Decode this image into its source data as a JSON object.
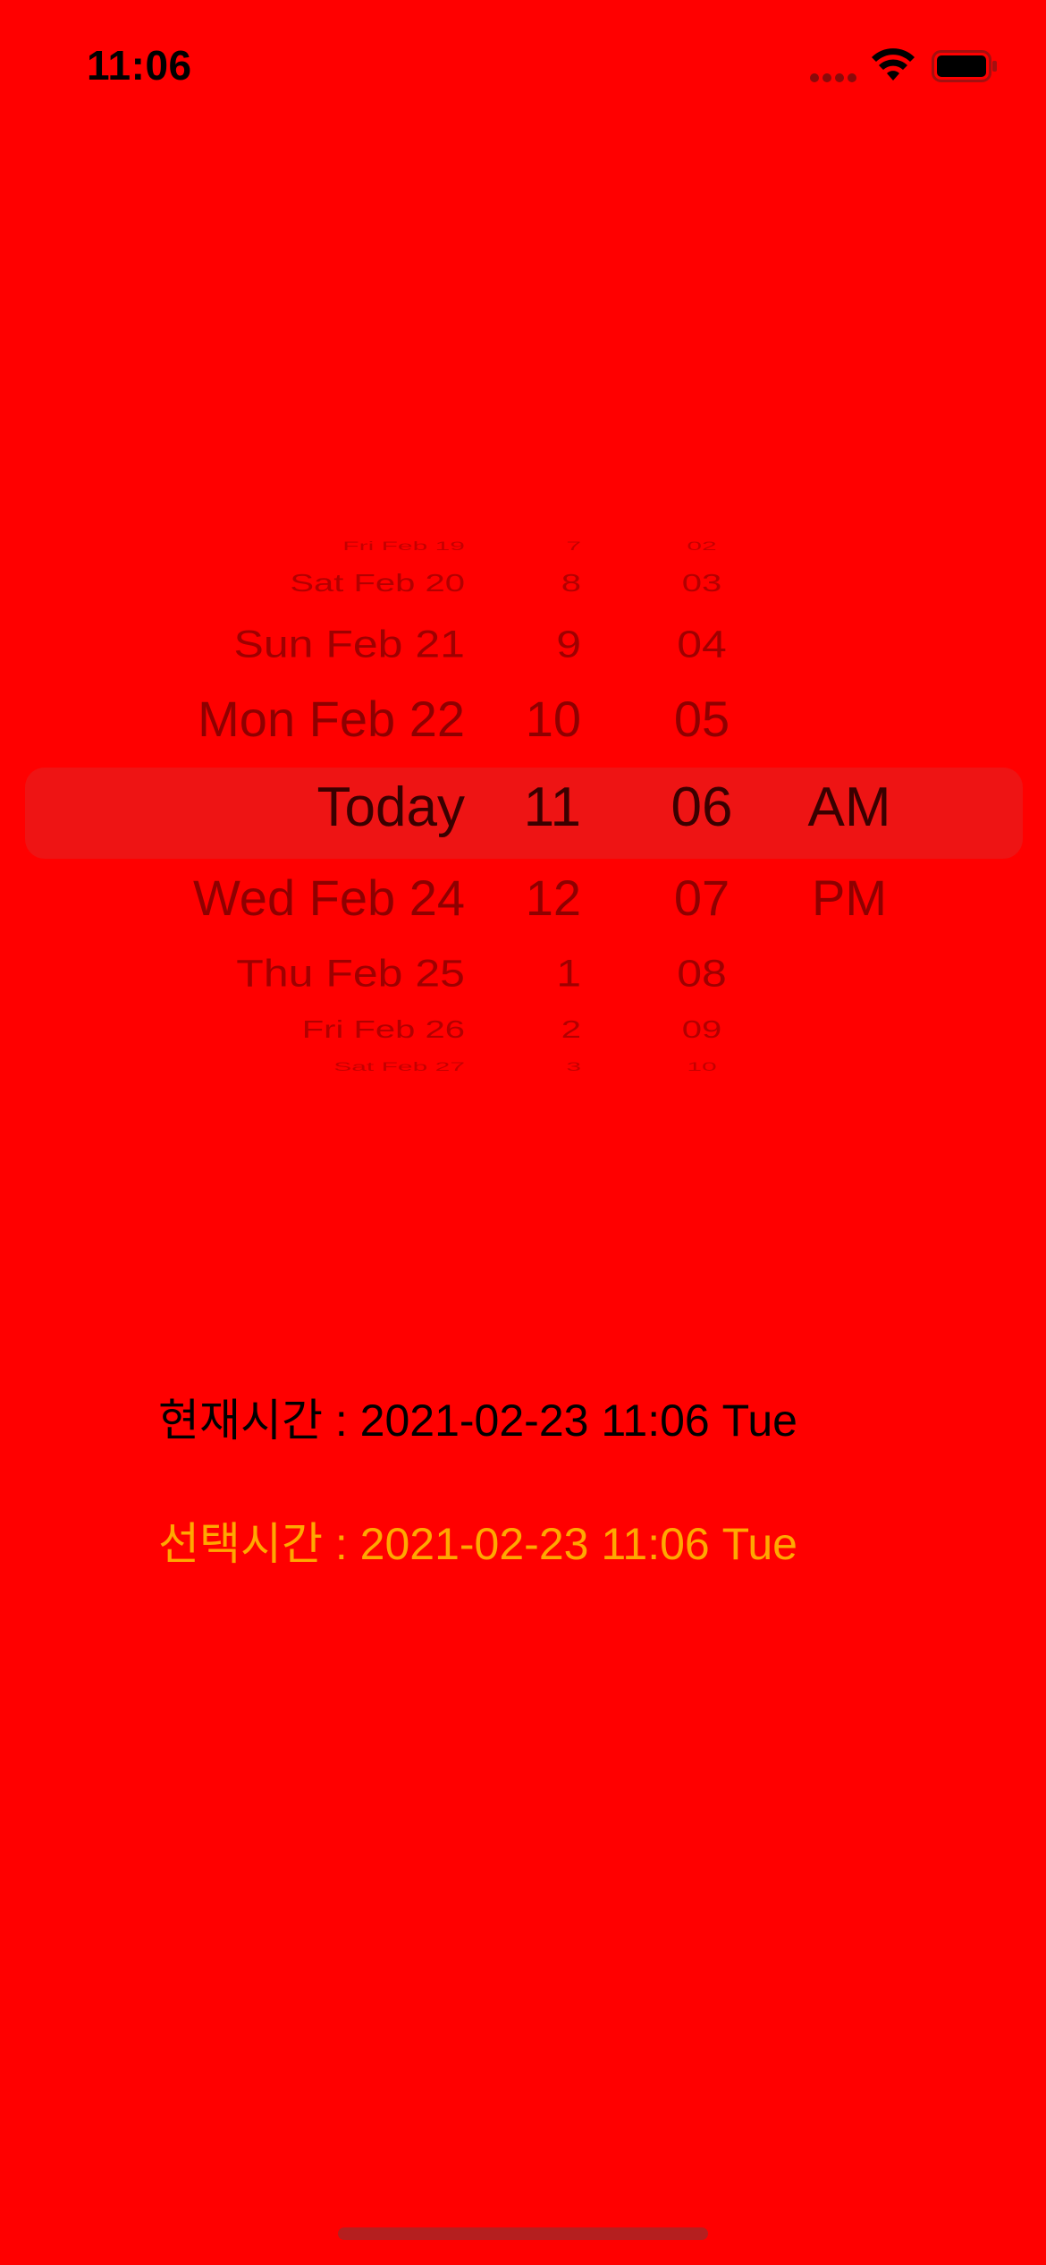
{
  "status_bar": {
    "time": "11:06",
    "icons": [
      "cellular-signal-icon",
      "wifi-icon",
      "battery-icon"
    ]
  },
  "picker": {
    "dates": [
      "Fri Feb 19",
      "Sat Feb 20",
      "Sun Feb 21",
      "Mon Feb 22",
      "Today",
      "Wed Feb 24",
      "Thu Feb 25",
      "Fri Feb 26",
      "Sat Feb 27"
    ],
    "hours": [
      "7",
      "8",
      "9",
      "10",
      "11",
      "12",
      "1",
      "2",
      "3"
    ],
    "minutes": [
      "02",
      "03",
      "04",
      "05",
      "06",
      "07",
      "08",
      "09",
      "10"
    ],
    "ampm": [
      "AM",
      "PM"
    ],
    "selected": {
      "date": "Today",
      "hour": "11",
      "minute": "06",
      "ampm": "AM"
    }
  },
  "info": {
    "current_time": "현재시간 : 2021-02-23 11:06 Tue",
    "selected_time": "선택시간 : 2021-02-23 11:06 Tue"
  },
  "colors": {
    "background": "#ff0000",
    "selection_band": "#ee1414",
    "selected_time_text": "#ffa800",
    "current_time_text": "#000000"
  }
}
